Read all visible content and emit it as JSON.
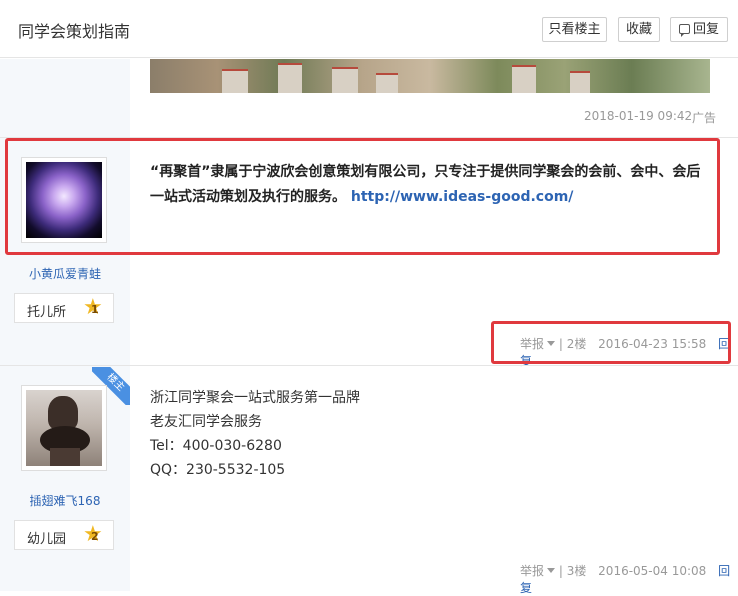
{
  "header": {
    "title": "同学会策划指南",
    "only_op_label": "只看楼主",
    "favorite_label": "收藏",
    "reply_label": "回复"
  },
  "ad": {
    "meta": "2018-01-19 09:42",
    "tag": "广告"
  },
  "posts": [
    {
      "username": "小黄瓜爱青蛙",
      "level_name": "托儿所",
      "level_num": "1",
      "content_bold": "“再聚首”隶属于宁波欣会创意策划有限公司，只专注于提供同学聚会的会前、会中、会后一站式活动策划及执行的服务。",
      "link": "http://www.ideas-good.com/",
      "report_label": "举报",
      "floor": "| 2楼",
      "time": "2016-04-23 15:58",
      "reply_label": "回复"
    },
    {
      "op_badge": "楼主",
      "username": "插翅难飞168",
      "level_name": "幼儿园",
      "level_num": "2",
      "lines": [
        "浙江同学聚会一站式服务第一品牌",
        "老友汇同学会服务",
        "Tel：400-030-6280",
        "QQ：230-5532-105"
      ],
      "report_label": "举报",
      "floor": "| 3楼",
      "time": "2016-05-04 10:08",
      "reply_label": "回复"
    }
  ],
  "colors": {
    "link": "#2d64b3",
    "highlight": "#e0393e",
    "star": "#f0b823",
    "op_ribbon": "#4a90e2"
  }
}
